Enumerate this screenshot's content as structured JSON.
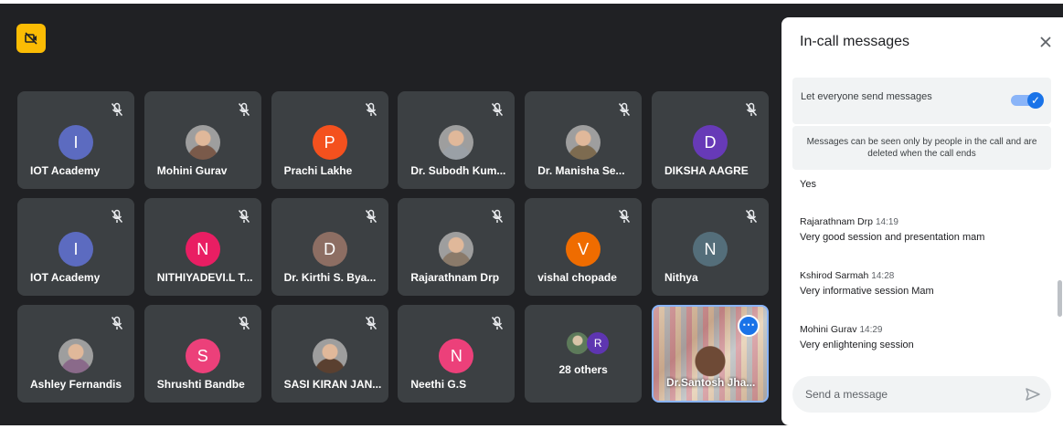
{
  "meeting": {
    "badge_icon": "camera-off-icon",
    "participants": [
      {
        "name": "IOT Academy",
        "initial": "I",
        "color": "#5c6bc0",
        "muted": true,
        "photo": false
      },
      {
        "name": "Mohini Gurav",
        "initial": "",
        "color": "#7a5a4a",
        "muted": true,
        "photo": true
      },
      {
        "name": "Prachi Lakhe",
        "initial": "P",
        "color": "#f4511e",
        "muted": true,
        "photo": false
      },
      {
        "name": "Dr. Subodh Kum...",
        "initial": "",
        "color": "#9aa0a6",
        "muted": true,
        "photo": true
      },
      {
        "name": "Dr. Manisha Se...",
        "initial": "",
        "color": "#7d6b50",
        "muted": true,
        "photo": true
      },
      {
        "name": "DIKSHA AAGRE",
        "initial": "D",
        "color": "#673ab7",
        "muted": true,
        "photo": false
      },
      {
        "name": "IOT Academy",
        "initial": "I",
        "color": "#5c6bc0",
        "muted": true,
        "photo": false
      },
      {
        "name": "NITHIYADEVI.L T...",
        "initial": "N",
        "color": "#e91e63",
        "muted": true,
        "photo": false
      },
      {
        "name": "Dr. Kirthi S. Bya...",
        "initial": "D",
        "color": "#8d6e63",
        "muted": true,
        "photo": false
      },
      {
        "name": "Rajarathnam Drp",
        "initial": "",
        "color": "#8a7a6a",
        "muted": true,
        "photo": true
      },
      {
        "name": "vishal chopade",
        "initial": "V",
        "color": "#ef6c00",
        "muted": true,
        "photo": false
      },
      {
        "name": "Nithya",
        "initial": "N",
        "color": "#546e7a",
        "muted": true,
        "photo": false
      },
      {
        "name": "Ashley Fernandis",
        "initial": "",
        "color": "#8a6a8a",
        "muted": true,
        "photo": true
      },
      {
        "name": "Shrushti Bandbe",
        "initial": "S",
        "color": "#ec407a",
        "muted": true,
        "photo": false
      },
      {
        "name": "SASI KIRAN JAN...",
        "initial": "",
        "color": "#5a4030",
        "muted": true,
        "photo": true
      },
      {
        "name": "Neethi G.S",
        "initial": "N",
        "color": "#ec407a",
        "muted": true,
        "photo": false
      }
    ],
    "others": {
      "label": "28 others",
      "initial": "R",
      "color": "#5e35b1"
    },
    "self_tile": {
      "name": "Dr.Santosh Jha..."
    }
  },
  "panel": {
    "title": "In-call messages",
    "setting_label": "Let everyone send messages",
    "setting_on": true,
    "notice": "Messages can be seen only by people in the call and are deleted when the call ends",
    "messages": [
      {
        "sender": "",
        "time": "",
        "text": "Yes"
      },
      {
        "sender": "Rajarathnam Drp",
        "time": "14:19",
        "text": "Very good session and presentation mam"
      },
      {
        "sender": "Kshirod Sarmah",
        "time": "14:28",
        "text": "Very informative session Mam"
      },
      {
        "sender": "Mohini Gurav",
        "time": "14:29",
        "text": "Very enlightening session"
      }
    ],
    "composer_placeholder": "Send a message",
    "composer_value": ""
  }
}
